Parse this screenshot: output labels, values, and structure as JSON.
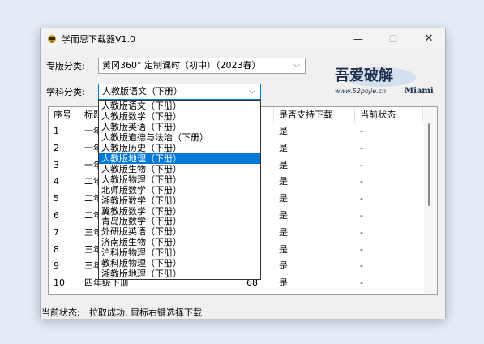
{
  "window": {
    "title": "学而思下载器V1.0",
    "minimize_glyph": "—",
    "maximize_glyph": "☐",
    "close_glyph": "✕"
  },
  "edition_filter": {
    "label": "专版分类:",
    "value": "黄冈360° 定制课时（初中）（2023春）"
  },
  "subject_filter": {
    "label": "学科分类:",
    "value": "人教版语文（下册）",
    "options": [
      "人教版语文（下册）",
      "人教版数学（下册）",
      "人教版英语（下册）",
      "人教版道德与法治（下册）",
      "人教版历史（下册）",
      "人教版地理（下册）",
      "人教版生物（下册）",
      "人教版物理（下册）",
      "北师版数学（下册）",
      "湘教版数学（下册）",
      "冀教版数学（下册）",
      "青岛版数学（下册）",
      "外研版英语（下册）",
      "济南版生物（下册）",
      "沪科版物理（下册）",
      "教科版物理（下册）",
      "湘教版地理（下册）"
    ],
    "highlighted_index": 5
  },
  "logo": {
    "main": "吾爱破解",
    "url": "www.52pojie.cn",
    "tag": "Miami"
  },
  "table": {
    "columns": [
      "序号",
      "标题",
      "数",
      "是否支持下载",
      "当前状态"
    ],
    "rows": [
      {
        "no": "1",
        "title": "一年",
        "count": "",
        "support": "是",
        "status": "-"
      },
      {
        "no": "2",
        "title": "一年",
        "count": "",
        "support": "是",
        "status": "-"
      },
      {
        "no": "3",
        "title": "一年",
        "count": "",
        "support": "是",
        "status": "-"
      },
      {
        "no": "4",
        "title": "二年",
        "count": "",
        "support": "是",
        "status": "-"
      },
      {
        "no": "5",
        "title": "二年",
        "count": "",
        "support": "是",
        "status": "-"
      },
      {
        "no": "6",
        "title": "二年",
        "count": "",
        "support": "是",
        "status": "-"
      },
      {
        "no": "7",
        "title": "三年",
        "count": "",
        "support": "是",
        "status": "-"
      },
      {
        "no": "8",
        "title": "三年",
        "count": "",
        "support": "是",
        "status": "-"
      },
      {
        "no": "9",
        "title": "三年",
        "count": "",
        "support": "是",
        "status": "-"
      },
      {
        "no": "10",
        "title": "四年级下册",
        "count": "68",
        "support": "是",
        "status": "-"
      }
    ]
  },
  "status": {
    "label": "当前状态:",
    "message": "拉取成功, 鼠标右键选择下载"
  }
}
